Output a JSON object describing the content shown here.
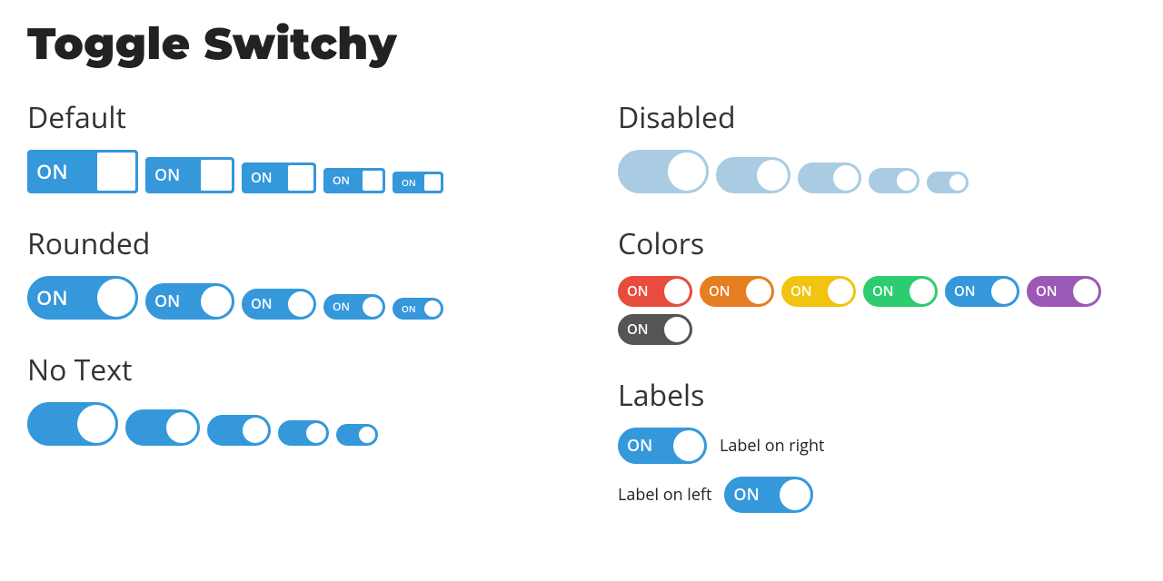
{
  "title": "Toggle Switchy",
  "sections": {
    "default": {
      "heading": "Default"
    },
    "rounded": {
      "heading": "Rounded"
    },
    "notext": {
      "heading": "No Text"
    },
    "disabled": {
      "heading": "Disabled"
    },
    "colors": {
      "heading": "Colors"
    },
    "labels": {
      "heading": "Labels"
    }
  },
  "on_label": "ON",
  "labels": {
    "right": "Label on right",
    "left": "Label on left"
  },
  "color_variants": [
    "red",
    "orange",
    "yellow",
    "green",
    "blue",
    "purple",
    "gray"
  ]
}
